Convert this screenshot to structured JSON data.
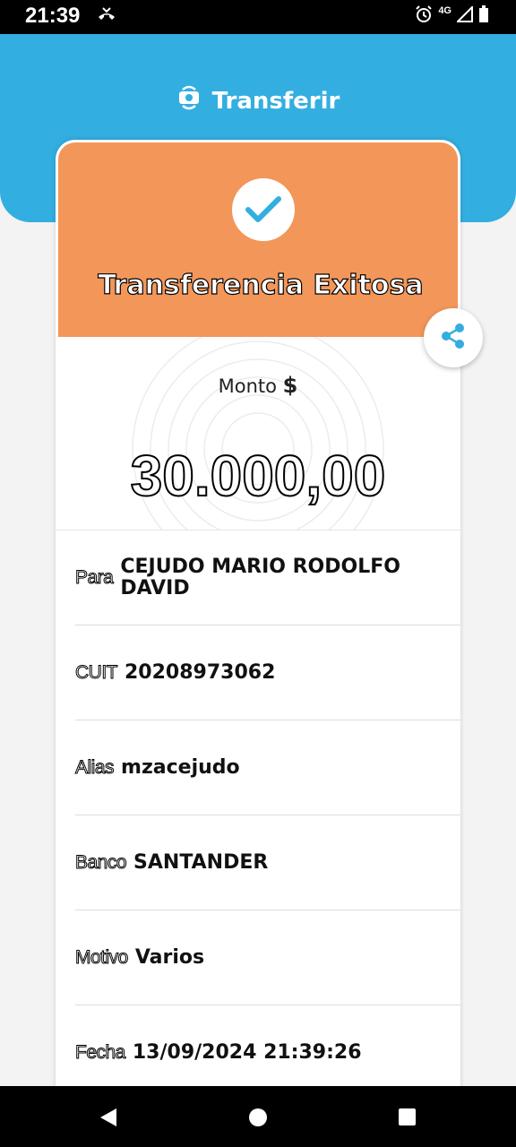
{
  "status_bar": {
    "time": "21:39",
    "network": "4G"
  },
  "header": {
    "title": "Transferir",
    "icon": "transfer-icon",
    "color": "#33aee0"
  },
  "result": {
    "title": "Transferencia Exitosa",
    "color": "#f39659"
  },
  "amount": {
    "label": "Monto",
    "currency": "$",
    "value": "30.000,00"
  },
  "details": [
    {
      "label": "Para",
      "value": "CEJUDO MARIO RODOLFO DAVID"
    },
    {
      "label": "CUIT",
      "value": "20208973062"
    },
    {
      "label": "Alias",
      "value": "mzacejudo"
    },
    {
      "label": "Banco",
      "value": "SANTANDER"
    },
    {
      "label": "Motivo",
      "value": "Varios"
    },
    {
      "label": "Fecha",
      "value": "13/09/2024 21:39:26"
    }
  ]
}
